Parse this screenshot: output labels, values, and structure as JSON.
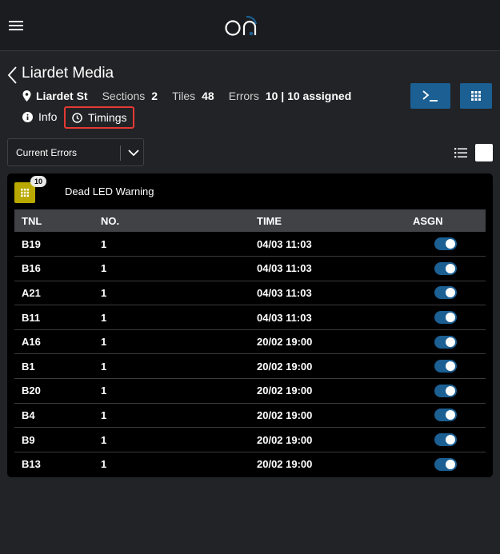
{
  "header": {
    "logo_text": "on",
    "colors": {
      "bar": "#1b1c1f",
      "logo_accent": "#1b5f93"
    }
  },
  "page": {
    "title": "Liardet Media",
    "location": "Liardet St",
    "sections_label": "Sections",
    "sections_value": "2",
    "tiles_label": "Tiles",
    "tiles_value": "48",
    "errors_label": "Errors",
    "errors_value": "10 | 10 assigned"
  },
  "tabs": {
    "info": "Info",
    "timings": "Timings"
  },
  "filter": {
    "selected": "Current Errors"
  },
  "card": {
    "title": "Dead LED Warning",
    "badge": "10",
    "columns": [
      "TNL",
      "NO.",
      "TIME",
      "ASGN"
    ],
    "rows": [
      {
        "tnl": "B19",
        "no": "1",
        "time": "04/03 11:03",
        "assigned": true
      },
      {
        "tnl": "B16",
        "no": "1",
        "time": "04/03 11:03",
        "assigned": true
      },
      {
        "tnl": "A21",
        "no": "1",
        "time": "04/03 11:03",
        "assigned": true
      },
      {
        "tnl": "B11",
        "no": "1",
        "time": "04/03 11:03",
        "assigned": true
      },
      {
        "tnl": "A16",
        "no": "1",
        "time": "20/02 19:00",
        "assigned": true
      },
      {
        "tnl": "B1",
        "no": "1",
        "time": "20/02 19:00",
        "assigned": true
      },
      {
        "tnl": "B20",
        "no": "1",
        "time": "20/02 19:00",
        "assigned": true
      },
      {
        "tnl": "B4",
        "no": "1",
        "time": "20/02 19:00",
        "assigned": true
      },
      {
        "tnl": "B9",
        "no": "1",
        "time": "20/02 19:00",
        "assigned": true
      },
      {
        "tnl": "B13",
        "no": "1",
        "time": "20/02 19:00",
        "assigned": true
      }
    ]
  },
  "icons": [
    "menu-icon",
    "back-chevron-icon",
    "location-pin-icon",
    "info-icon",
    "clock-icon",
    "terminal-icon",
    "grid-icon",
    "chevron-down-icon",
    "list-icon"
  ],
  "colors": {
    "accent": "#1b5f93",
    "highlight": "#e53935",
    "warning_tile": "#b8a800",
    "background": "#222326"
  }
}
